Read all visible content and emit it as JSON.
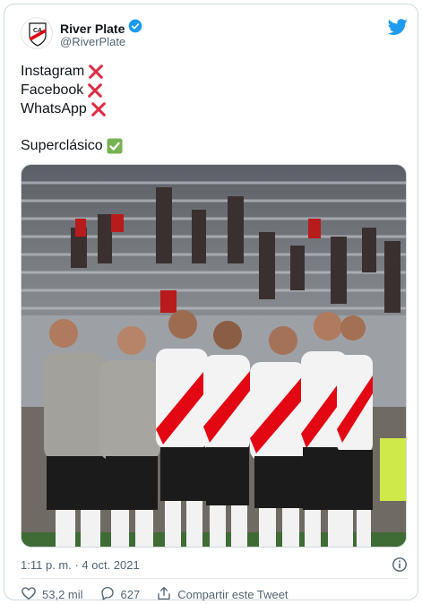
{
  "tweet": {
    "display_name": "River Plate",
    "handle": "@RiverPlate",
    "lines": [
      {
        "text": "Instagram",
        "emoji": "cross-mark"
      },
      {
        "text": "Facebook",
        "emoji": "cross-mark"
      },
      {
        "text": "WhatsApp",
        "emoji": "cross-mark"
      },
      {
        "text": "Superclásico",
        "emoji": "check-mark"
      }
    ],
    "timestamp": "1:11 p. m. · 4 oct. 2021",
    "likes": "53,2 mil",
    "replies": "627",
    "share_label": "Compartir este Tweet"
  },
  "colors": {
    "verified": "#1d9bf0",
    "twitter_blue": "#1d9bf0",
    "cross": "#dd2e44",
    "check": "#77b255",
    "river_red": "#e30613"
  }
}
